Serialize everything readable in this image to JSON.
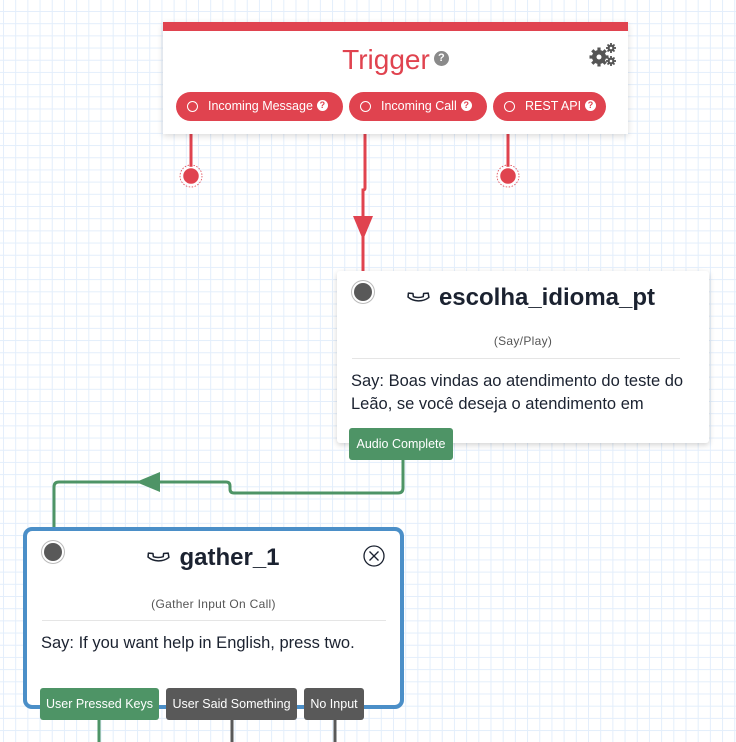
{
  "trigger": {
    "title": "Trigger",
    "help_icon": "question-circle-icon",
    "settings_icon": "gears-icon",
    "accent_color": "#e0434f",
    "outputs": [
      {
        "label": "Incoming Message",
        "icon": "radio-circle-icon",
        "help_icon": "question-circle-icon"
      },
      {
        "label": "Incoming Call",
        "icon": "radio-circle-icon",
        "help_icon": "question-circle-icon"
      },
      {
        "label": "REST API",
        "icon": "radio-circle-icon",
        "help_icon": "question-circle-icon"
      }
    ]
  },
  "nodes": [
    {
      "name": "escolha_idioma_pt",
      "icon": "phone-icon",
      "type": "(Say/Play)",
      "body": "Say: Boas vindas ao atendimento do teste do Leão, se você deseja o atendimento em",
      "outputs": [
        {
          "label": "Audio Complete",
          "color": "#4e9466"
        }
      ]
    },
    {
      "name": "gather_1",
      "icon": "phone-icon",
      "type": "(Gather Input On Call)",
      "body": "Say: If you want help in English, press two.",
      "selected": true,
      "border_color": "#4b8fc8",
      "close_icon": "close-circle-icon",
      "outputs": [
        {
          "label": "User Pressed Keys",
          "color": "#4e9466"
        },
        {
          "label": "User Said Something",
          "color": "#595959"
        },
        {
          "label": "No Input",
          "color": "#595959"
        }
      ]
    }
  ],
  "connections": [
    {
      "from": "Incoming Call",
      "to": "escolha_idioma_pt",
      "color": "#e0434f"
    },
    {
      "from": "Audio Complete",
      "to": "gather_1",
      "color": "#4e9466"
    }
  ]
}
